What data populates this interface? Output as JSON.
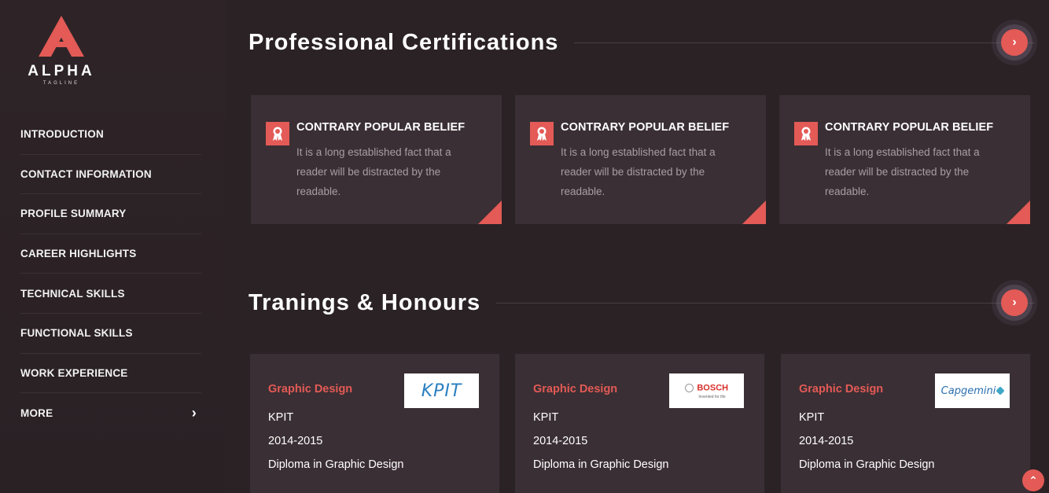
{
  "brand": {
    "name": "ALPHA",
    "tagline": "TAGLINE",
    "accent": "#e35a56"
  },
  "nav": {
    "items": [
      {
        "label": "INTRODUCTION"
      },
      {
        "label": "CONTACT INFORMATION"
      },
      {
        "label": "PROFILE SUMMARY"
      },
      {
        "label": "CAREER HIGHLIGHTS"
      },
      {
        "label": "TECHNICAL SKILLS"
      },
      {
        "label": "FUNCTIONAL SKILLS"
      },
      {
        "label": "WORK EXPERIENCE"
      },
      {
        "label": "MORE"
      }
    ],
    "more_icon": "chevron-right-icon"
  },
  "certifications": {
    "title": "Professional Certifications",
    "cards": [
      {
        "title": "CONTRARY POPULAR BELIEF",
        "desc": "It is a long established fact that a reader will be distracted by the readable.",
        "icon": "award-icon"
      },
      {
        "title": "CONTRARY POPULAR BELIEF",
        "desc": "It is a long established fact that a reader will be distracted by the readable.",
        "icon": "award-icon"
      },
      {
        "title": "CONTRARY POPULAR BELIEF",
        "desc": "It is a long established fact that a reader will be distracted by the readable.",
        "icon": "award-icon"
      }
    ]
  },
  "trainings": {
    "title": "Tranings & Honours",
    "cards": [
      {
        "title": "Graphic Design",
        "company": "KPIT",
        "years": "2014-2015",
        "degree": "Diploma in Graphic Design",
        "logo": "KPIT"
      },
      {
        "title": "Graphic Design",
        "company": "KPIT",
        "years": "2014-2015",
        "degree": "Diploma in Graphic Design",
        "logo": "BOSCH",
        "logo_sub": "Invented for life"
      },
      {
        "title": "Graphic Design",
        "company": "KPIT",
        "years": "2014-2015",
        "degree": "Diploma in Graphic Design",
        "logo": "Capgemini"
      }
    ]
  }
}
